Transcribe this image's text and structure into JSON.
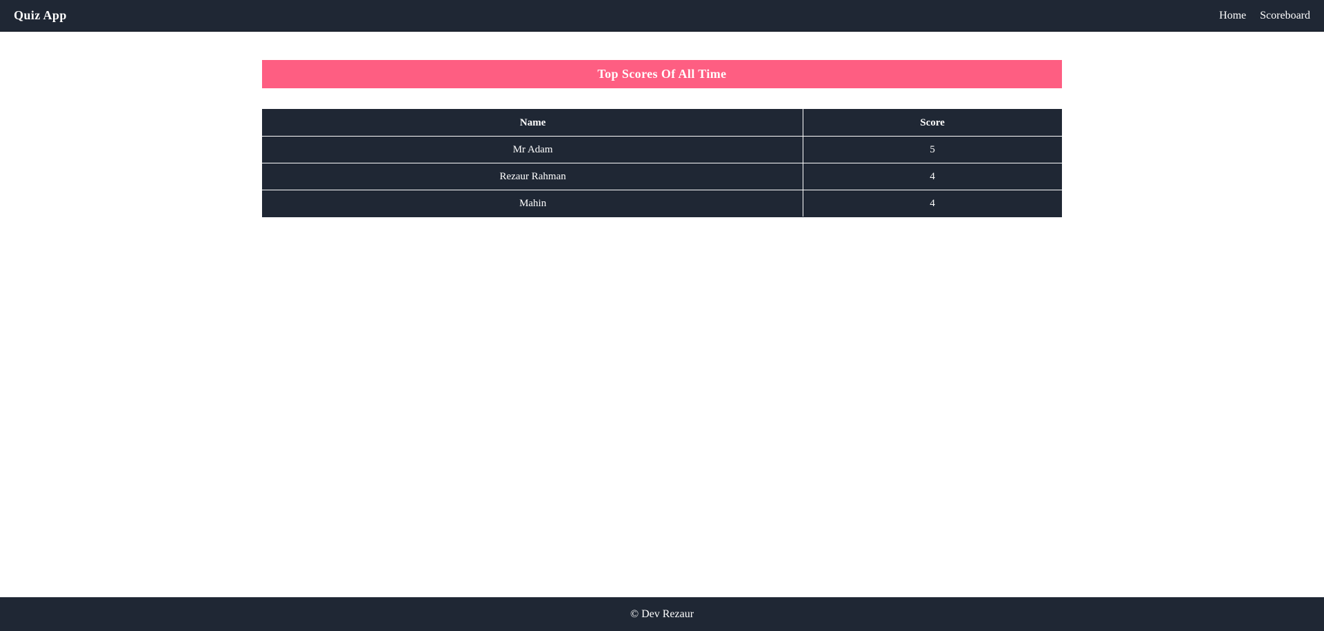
{
  "navbar": {
    "brand": "Quiz App",
    "links": [
      {
        "label": "Home"
      },
      {
        "label": "Scoreboard"
      }
    ]
  },
  "main": {
    "banner_title": "Top Scores Of All Time",
    "table": {
      "headers": [
        "Name",
        "Score"
      ],
      "rows": [
        {
          "name": "Mr Adam",
          "score": "5"
        },
        {
          "name": "Rezaur Rahman",
          "score": "4"
        },
        {
          "name": "Mahin",
          "score": "4"
        }
      ]
    }
  },
  "footer": {
    "text": "© Dev Rezaur"
  },
  "colors": {
    "navbar_bg": "#1f2734",
    "banner_bg": "#fe5e82",
    "table_bg": "#1f2734",
    "text": "#ffffff"
  }
}
